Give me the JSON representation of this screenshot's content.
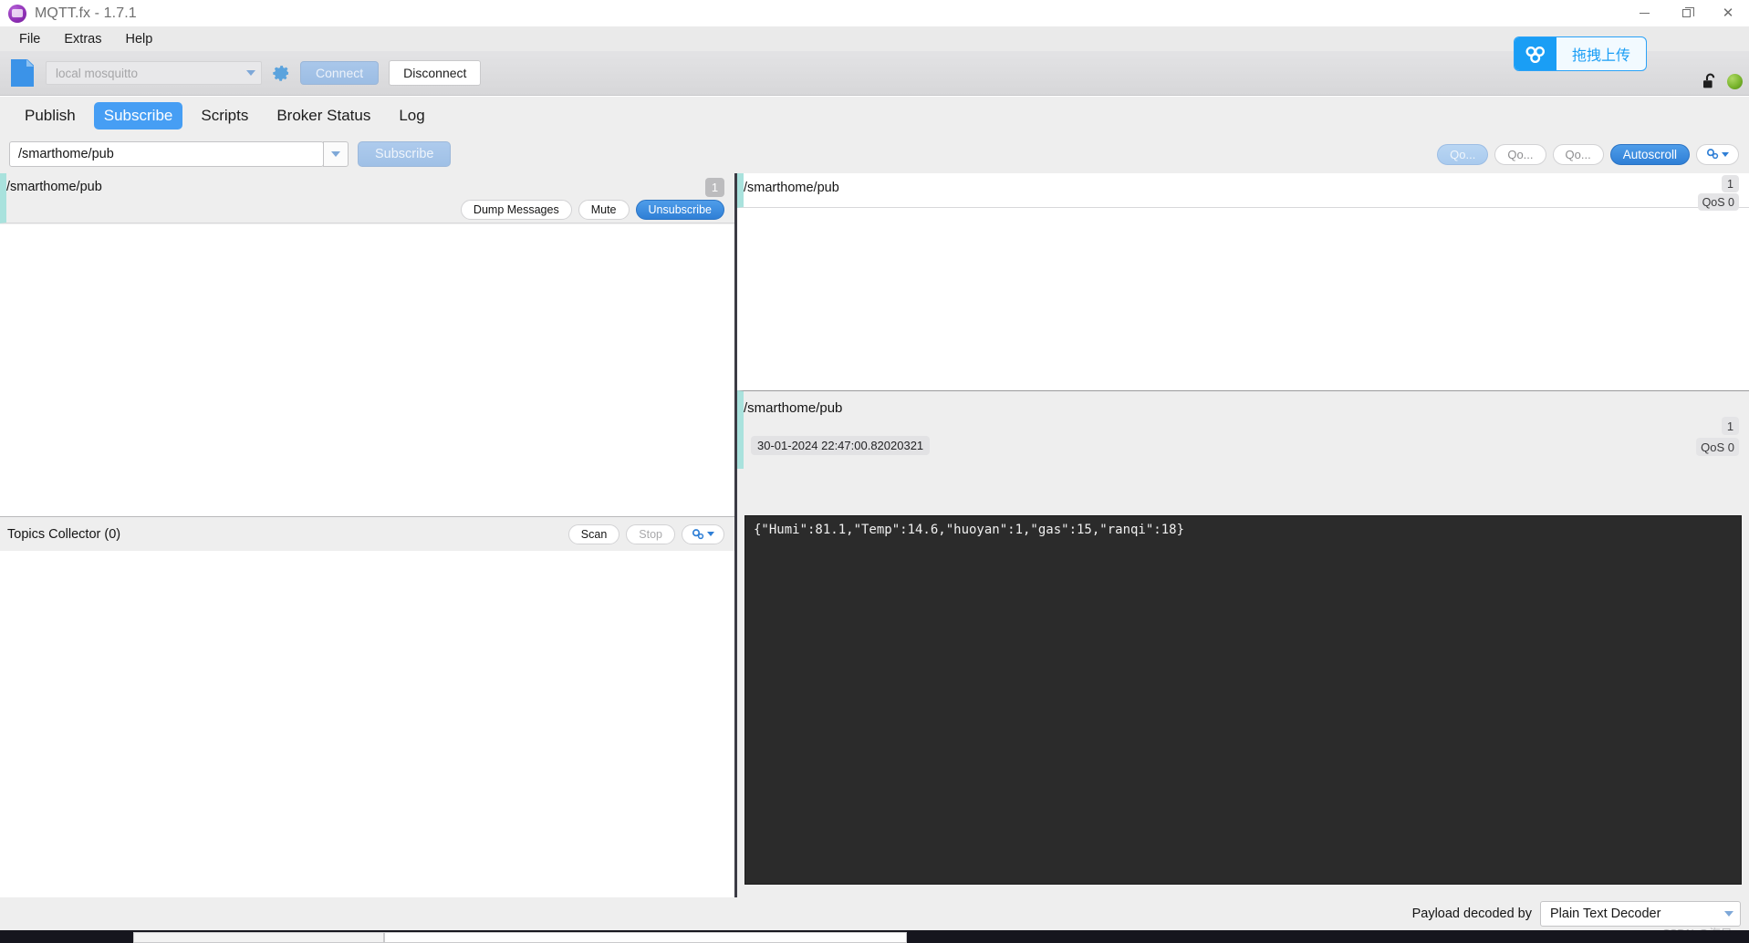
{
  "window": {
    "title": "MQTT.fx - 1.7.1",
    "logo_icon": "mqtt-fx-logo-icon",
    "minimize_icon": "minimize-icon",
    "maximize_icon": "restore-icon",
    "close_icon": "close-icon"
  },
  "menu": {
    "items": [
      {
        "label": "File"
      },
      {
        "label": "Extras"
      },
      {
        "label": "Help"
      }
    ]
  },
  "toolbar": {
    "file_icon": "file-icon",
    "connection_profile": "local mosquitto",
    "gear_icon": "gear-icon",
    "connect_label": "Connect",
    "disconnect_label": "Disconnect",
    "upload_label": "拖拽上传",
    "upload_icon": "cloud-upload-icon",
    "lock_icon": "unlocked-padlock-icon",
    "status_icon": "green-status-dot",
    "accent_blue": "#1a9ef5"
  },
  "tabs": [
    {
      "label": "Publish",
      "active": false
    },
    {
      "label": "Subscribe",
      "active": true
    },
    {
      "label": "Scripts",
      "active": false
    },
    {
      "label": "Broker Status",
      "active": false
    },
    {
      "label": "Log",
      "active": false
    }
  ],
  "subscribe_bar": {
    "topic_value": "/smarthome/pub",
    "dropdown_icon": "chevron-down-icon",
    "subscribe_label": "Subscribe",
    "qos_buttons": [
      {
        "label": "Qo...",
        "selected": true
      },
      {
        "label": "Qo...",
        "selected": false
      },
      {
        "label": "Qo...",
        "selected": false
      }
    ],
    "autoscroll_label": "Autoscroll",
    "options_icon": "gear-dropdown-icon"
  },
  "subscriptions": [
    {
      "topic": "/smarthome/pub",
      "count": "1",
      "dump_label": "Dump Messages",
      "mute_label": "Mute",
      "unsubscribe_label": "Unsubscribe"
    }
  ],
  "topics_collector": {
    "title": "Topics Collector (0)",
    "scan_label": "Scan",
    "stop_label": "Stop",
    "options_icon": "gear-dropdown-icon"
  },
  "messages": [
    {
      "topic": "/smarthome/pub",
      "count": "1",
      "qos": "QoS 0"
    }
  ],
  "message_detail": {
    "topic": "/smarthome/pub",
    "count": "1",
    "qos": "QoS 0",
    "timestamp": "30-01-2024  22:47:00.82020321",
    "payload": "{\"Humi\":81.1,\"Temp\":14.6,\"huoyan\":1,\"gas\":15,\"ranqi\":18}"
  },
  "footer": {
    "decoder_label": "Payload decoded by",
    "decoder_value": "Plain Text Decoder",
    "dropdown_icon": "chevron-down-icon"
  },
  "watermark": "CSDN @海风-"
}
